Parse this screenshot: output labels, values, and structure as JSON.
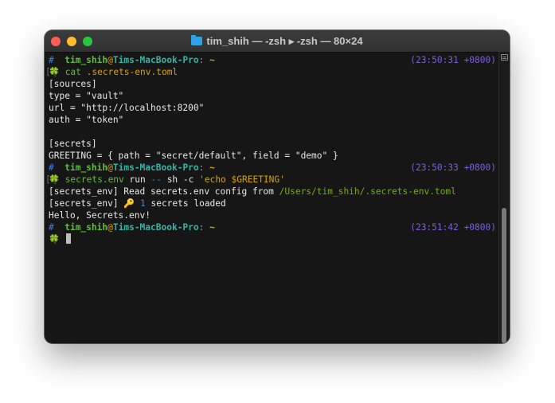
{
  "window": {
    "title": "tim_shih — -zsh ▸ -zsh — 80×24"
  },
  "prompt": {
    "hash": "#",
    "user": "tim_shih",
    "at": "@",
    "host": "Tims-MacBook-Pro",
    "colon": ":",
    "dir": "~",
    "clover": "🍀"
  },
  "session": [
    {
      "time": "(23:50:31 +0800)",
      "command": {
        "name": "cat",
        "arg": ".secrets-env.toml"
      }
    },
    {
      "time": "(23:50:33 +0800)",
      "command": {
        "name": "secrets.env",
        "rest": " run ",
        "flag": "--",
        "rest2": " sh -c ",
        "str": "'echo $GREETING'"
      }
    },
    {
      "time": "(23:51:42 +0800)"
    }
  ],
  "output1": [
    "[sources]",
    "type = \"vault\"",
    "url = \"http://localhost:8200\"",
    "auth = \"token\"",
    "",
    "[secrets]",
    "GREETING = { path = \"secret/default\", field = \"demo\" }"
  ],
  "output2": {
    "read_prefix": "[secrets_env] Read secrets.env config from ",
    "read_path": "/Users/tim_shih/.secrets-env.toml",
    "loaded_prefix": "[secrets_env] ",
    "key_icon": "🔑",
    "loaded_count": "1",
    "loaded_suffix": " secrets loaded",
    "hello": "Hello, Secrets.env!"
  }
}
